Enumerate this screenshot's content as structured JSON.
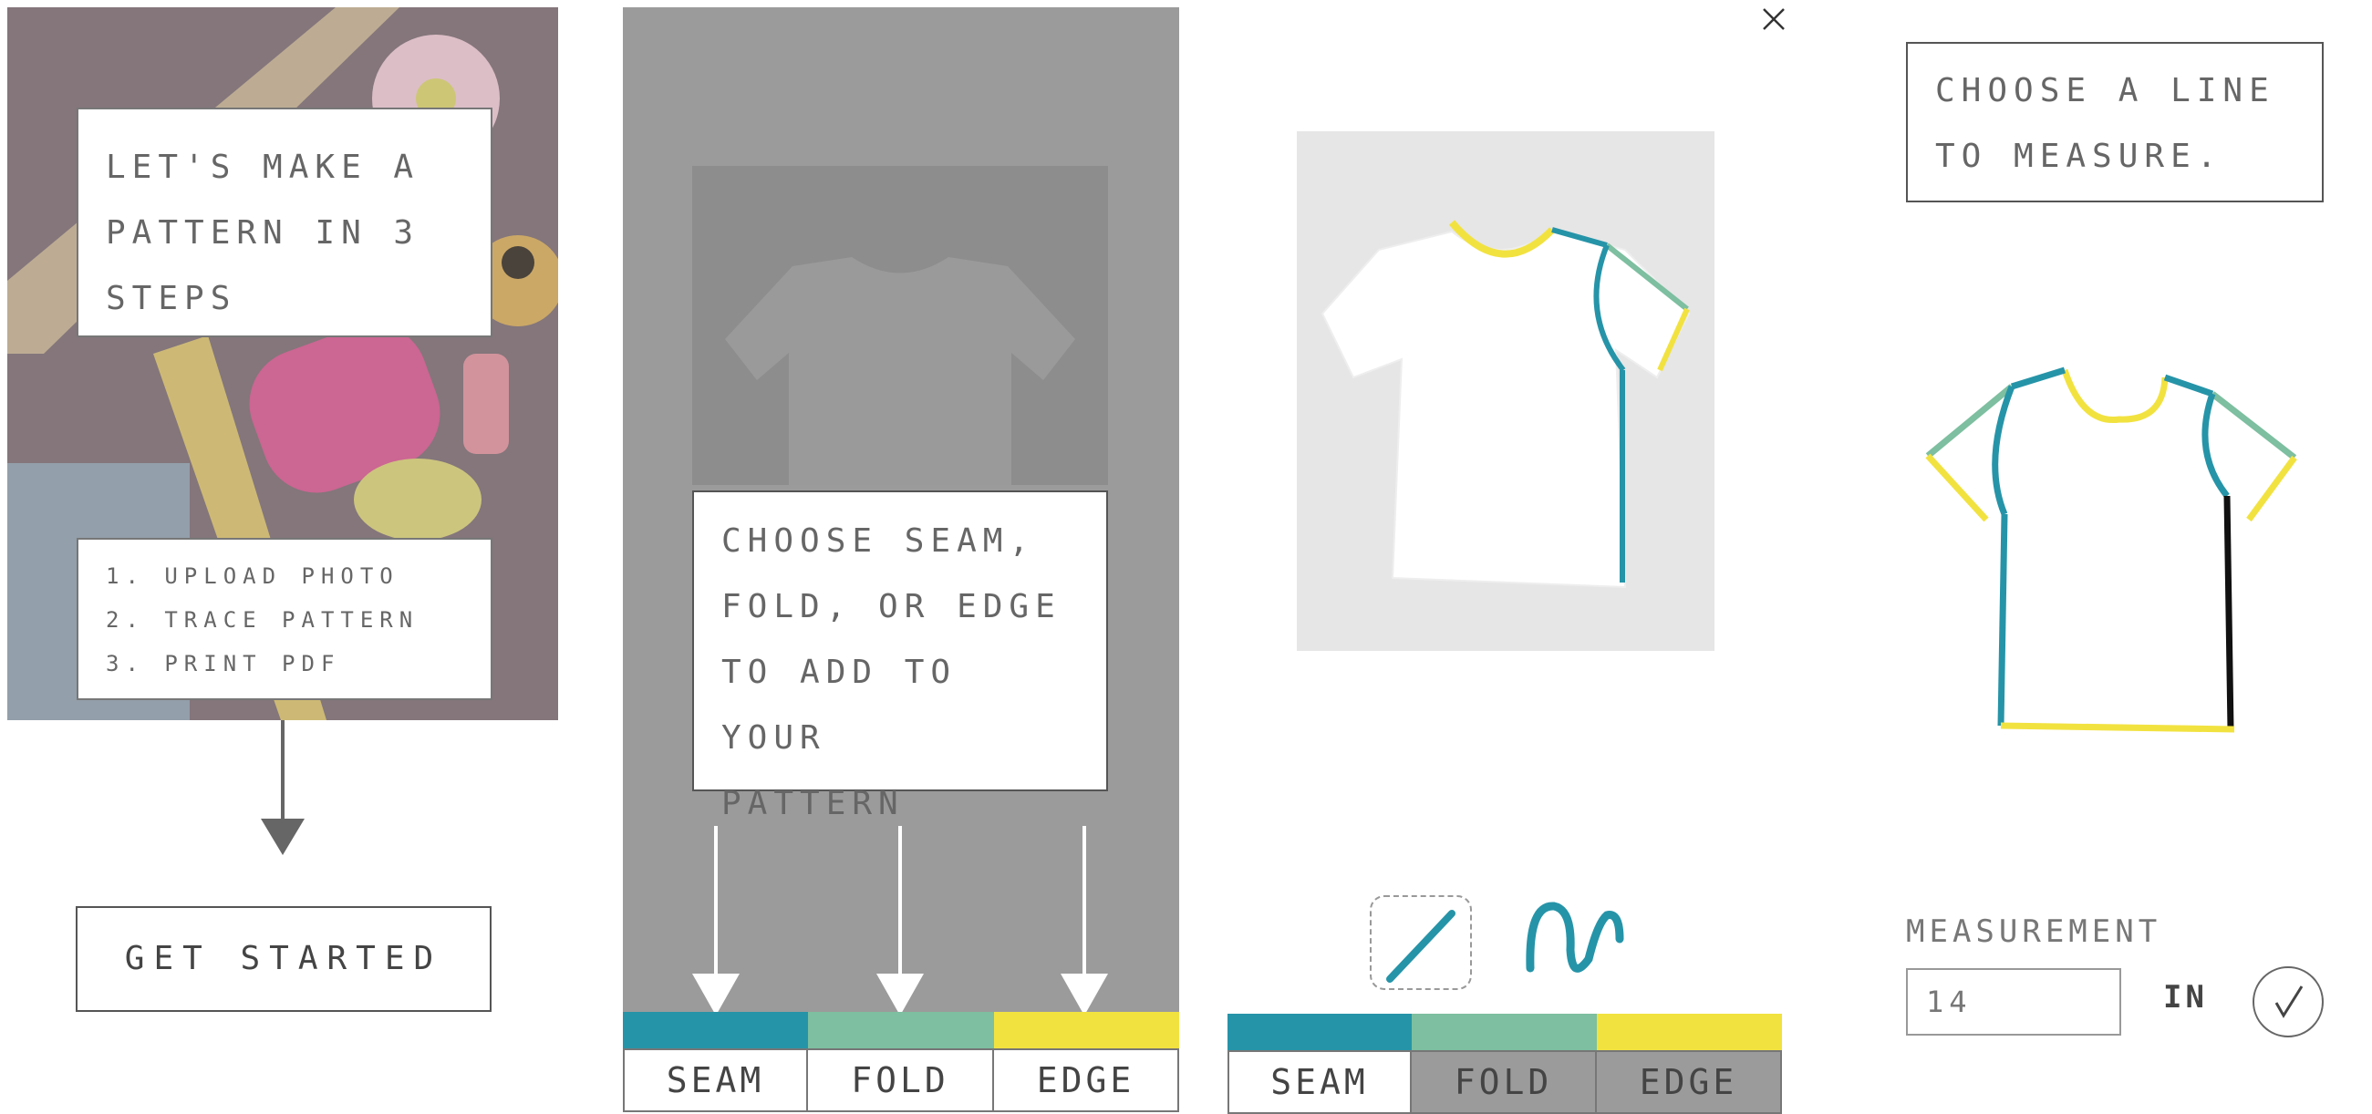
{
  "colors": {
    "seam": "#2694A8",
    "fold": "#7DBFA0",
    "edge": "#F2E240",
    "grey": "#9B9B9B"
  },
  "screen1": {
    "intro_lines": [
      "Let's make a",
      "pattern in 3",
      "steps"
    ],
    "steps": [
      "1. Upload photo",
      "2. Trace pattern",
      "3. Print PDF"
    ],
    "get_started_label": "Get started"
  },
  "screen2": {
    "instruction_lines": [
      "Choose seam,",
      "fold, or edge",
      "to add to your",
      "pattern"
    ],
    "tabs": [
      "Seam",
      "Fold",
      "Edge"
    ]
  },
  "screen3": {
    "tabs": [
      "Seam",
      "Fold",
      "Edge"
    ],
    "tools": [
      "straight-line-tool",
      "curve-tool"
    ]
  },
  "screen4": {
    "instruction_lines": [
      "Choose a line",
      "to measure."
    ],
    "measurement_label": "Measurement",
    "measurement_value": "14",
    "unit_label": "in"
  }
}
